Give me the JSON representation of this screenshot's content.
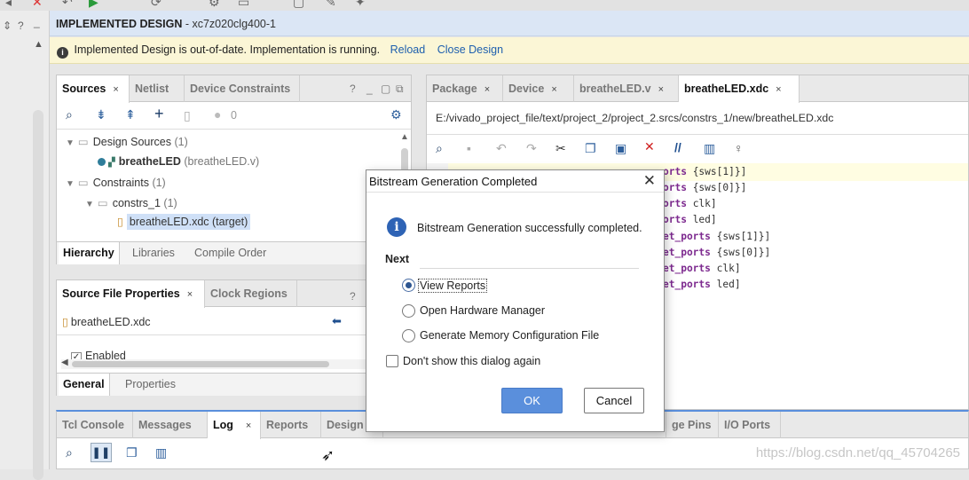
{
  "design_banner": {
    "title": "IMPLEMENTED DESIGN",
    "part": " - xc7z020clg400-1"
  },
  "warning": {
    "message": "Implemented Design is out-of-date. Implementation is running.",
    "reload": "Reload",
    "close": "Close Design"
  },
  "left_rail": {
    "item1": "⇕",
    "item2": "?",
    "item3": "_"
  },
  "sources_panel": {
    "tabs": [
      "Sources",
      "Netlist",
      "Device Constraints"
    ],
    "close": "×",
    "toolbar_count": "0",
    "tree": {
      "design_sources": "Design Sources",
      "design_sources_count": "(1)",
      "top_module": "breatheLED",
      "top_module_file": "(breatheLED.v)",
      "constraints": "Constraints",
      "constraints_count": "(1)",
      "constrs": "constrs_1",
      "constrs_count": "(1)",
      "xdc": "breatheLED.xdc (target)"
    },
    "subtabs": [
      "Hierarchy",
      "Libraries",
      "Compile Order"
    ]
  },
  "props_panel": {
    "tabs": [
      "Source File Properties",
      "Clock Regions"
    ],
    "file": "breatheLED.xdc",
    "enabled": "Enabled",
    "subtabs": [
      "General",
      "Properties"
    ]
  },
  "editor": {
    "tabs": [
      "Package",
      "Device",
      "breatheLED.v",
      "breatheLED.xdc"
    ],
    "path": "E:/vivado_project_file/text/project_2/project_2.srcs/constrs_1/new/breatheLED.xdc",
    "lines": [
      {
        "kw": "orts",
        "rest": " {sws[1]}]"
      },
      {
        "kw": "orts",
        "rest": " {sws[0]}]"
      },
      {
        "kw": "orts",
        "rest": " clk]"
      },
      {
        "kw": "orts",
        "rest": " led]"
      },
      {
        "kw": "et_ports",
        "rest": " {sws[1]}]"
      },
      {
        "kw": "et_ports",
        "rest": " {sws[0]}]"
      },
      {
        "kw": "et_ports",
        "rest": " clk]"
      },
      {
        "kw": "et_ports",
        "rest": " led]"
      }
    ]
  },
  "dialog": {
    "title": "Bitstream Generation Completed",
    "message": "Bitstream Generation successfully completed.",
    "next_label": "Next",
    "options": [
      "View Reports",
      "Open Hardware Manager",
      "Generate Memory Configuration File"
    ],
    "selected": 0,
    "dont_show": "Don't show this dialog again",
    "ok": "OK",
    "cancel": "Cancel"
  },
  "console": {
    "tabs": [
      "Tcl Console",
      "Messages",
      "Log",
      "Reports",
      "Design R"
    ],
    "right_tabs": [
      "ge Pins",
      "I/O Ports"
    ]
  },
  "watermark": "https://blog.csdn.net/qq_45704265",
  "colors": {
    "banner_bg": "#dbe6f5",
    "warning_bg": "#fbf6d6",
    "link": "#1e5fae",
    "ok_button": "#5a8fdc",
    "selection": "#cfe0f7"
  }
}
